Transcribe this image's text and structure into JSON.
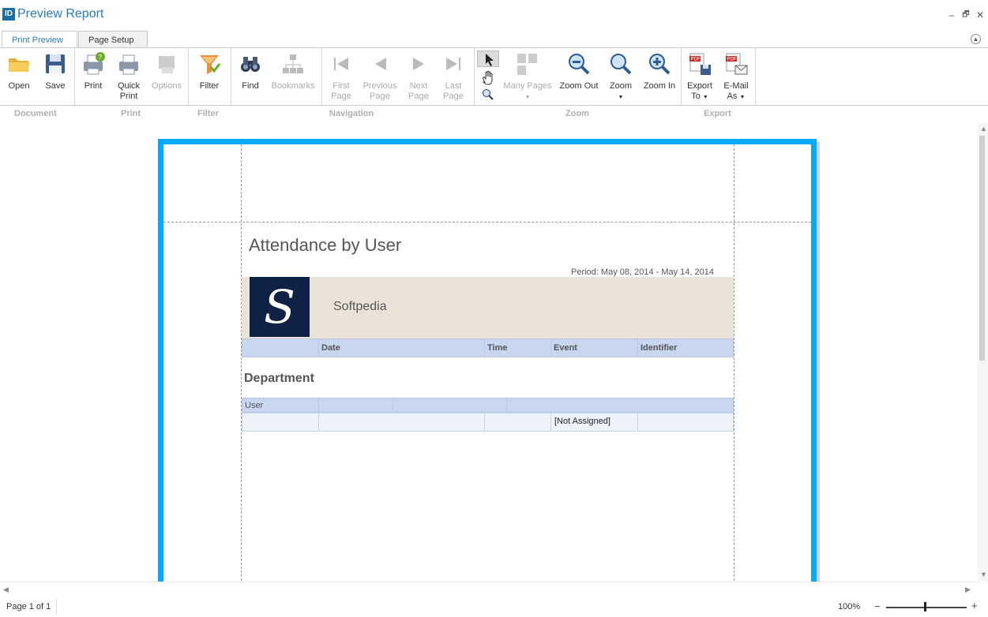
{
  "window": {
    "app_icon": "ID",
    "title": "Preview Report",
    "minimize": "–",
    "restore": "🗗",
    "close": "✕"
  },
  "tabs": [
    {
      "label": "Print Preview"
    },
    {
      "label": "Page Setup"
    }
  ],
  "ribbon": {
    "document": {
      "open": "Open",
      "save": "Save"
    },
    "print": {
      "print": "Print",
      "quick": "Quick",
      "quick2": "Print",
      "options": "Options"
    },
    "filter": {
      "filter": "Filter"
    },
    "navigation": {
      "find": "Find",
      "bookmarks": "Bookmarks",
      "first": "First",
      "previous": "Previous",
      "next": "Next",
      "last": "Last",
      "page": "Page"
    },
    "zoom": {
      "many_pages": "Many Pages",
      "zoom_out": "Zoom Out",
      "zoom": "Zoom",
      "zoom_in": "Zoom In"
    },
    "export": {
      "export_to": "Export",
      "export_to2": "To",
      "email": "E-Mail",
      "email2": "As"
    },
    "groups": {
      "document": "Document",
      "print": "Print",
      "filter": "Filter",
      "navigation": "Navigation",
      "zoom": "Zoom",
      "export": "Export"
    }
  },
  "report": {
    "title": "Attendance by User",
    "period": "Period: May 08, 2014 - May 14, 2014",
    "logo_letter": "S",
    "company": "Softpedia",
    "columns": [
      "Date",
      "Time",
      "Event",
      "Identifier"
    ],
    "department": "Department",
    "user_label": "User",
    "event_value": "[Not Assigned]"
  },
  "status": {
    "page": "Page 1 of 1",
    "zoom": "100%",
    "zoom_minus": "−",
    "zoom_plus": "+"
  },
  "colors": {
    "accent": "#2a7ab8",
    "page_border": "#00aaff",
    "header_bg": "#c9d6ef",
    "banner_bg": "#eae3d8",
    "logo_bg": "#0f2246"
  }
}
